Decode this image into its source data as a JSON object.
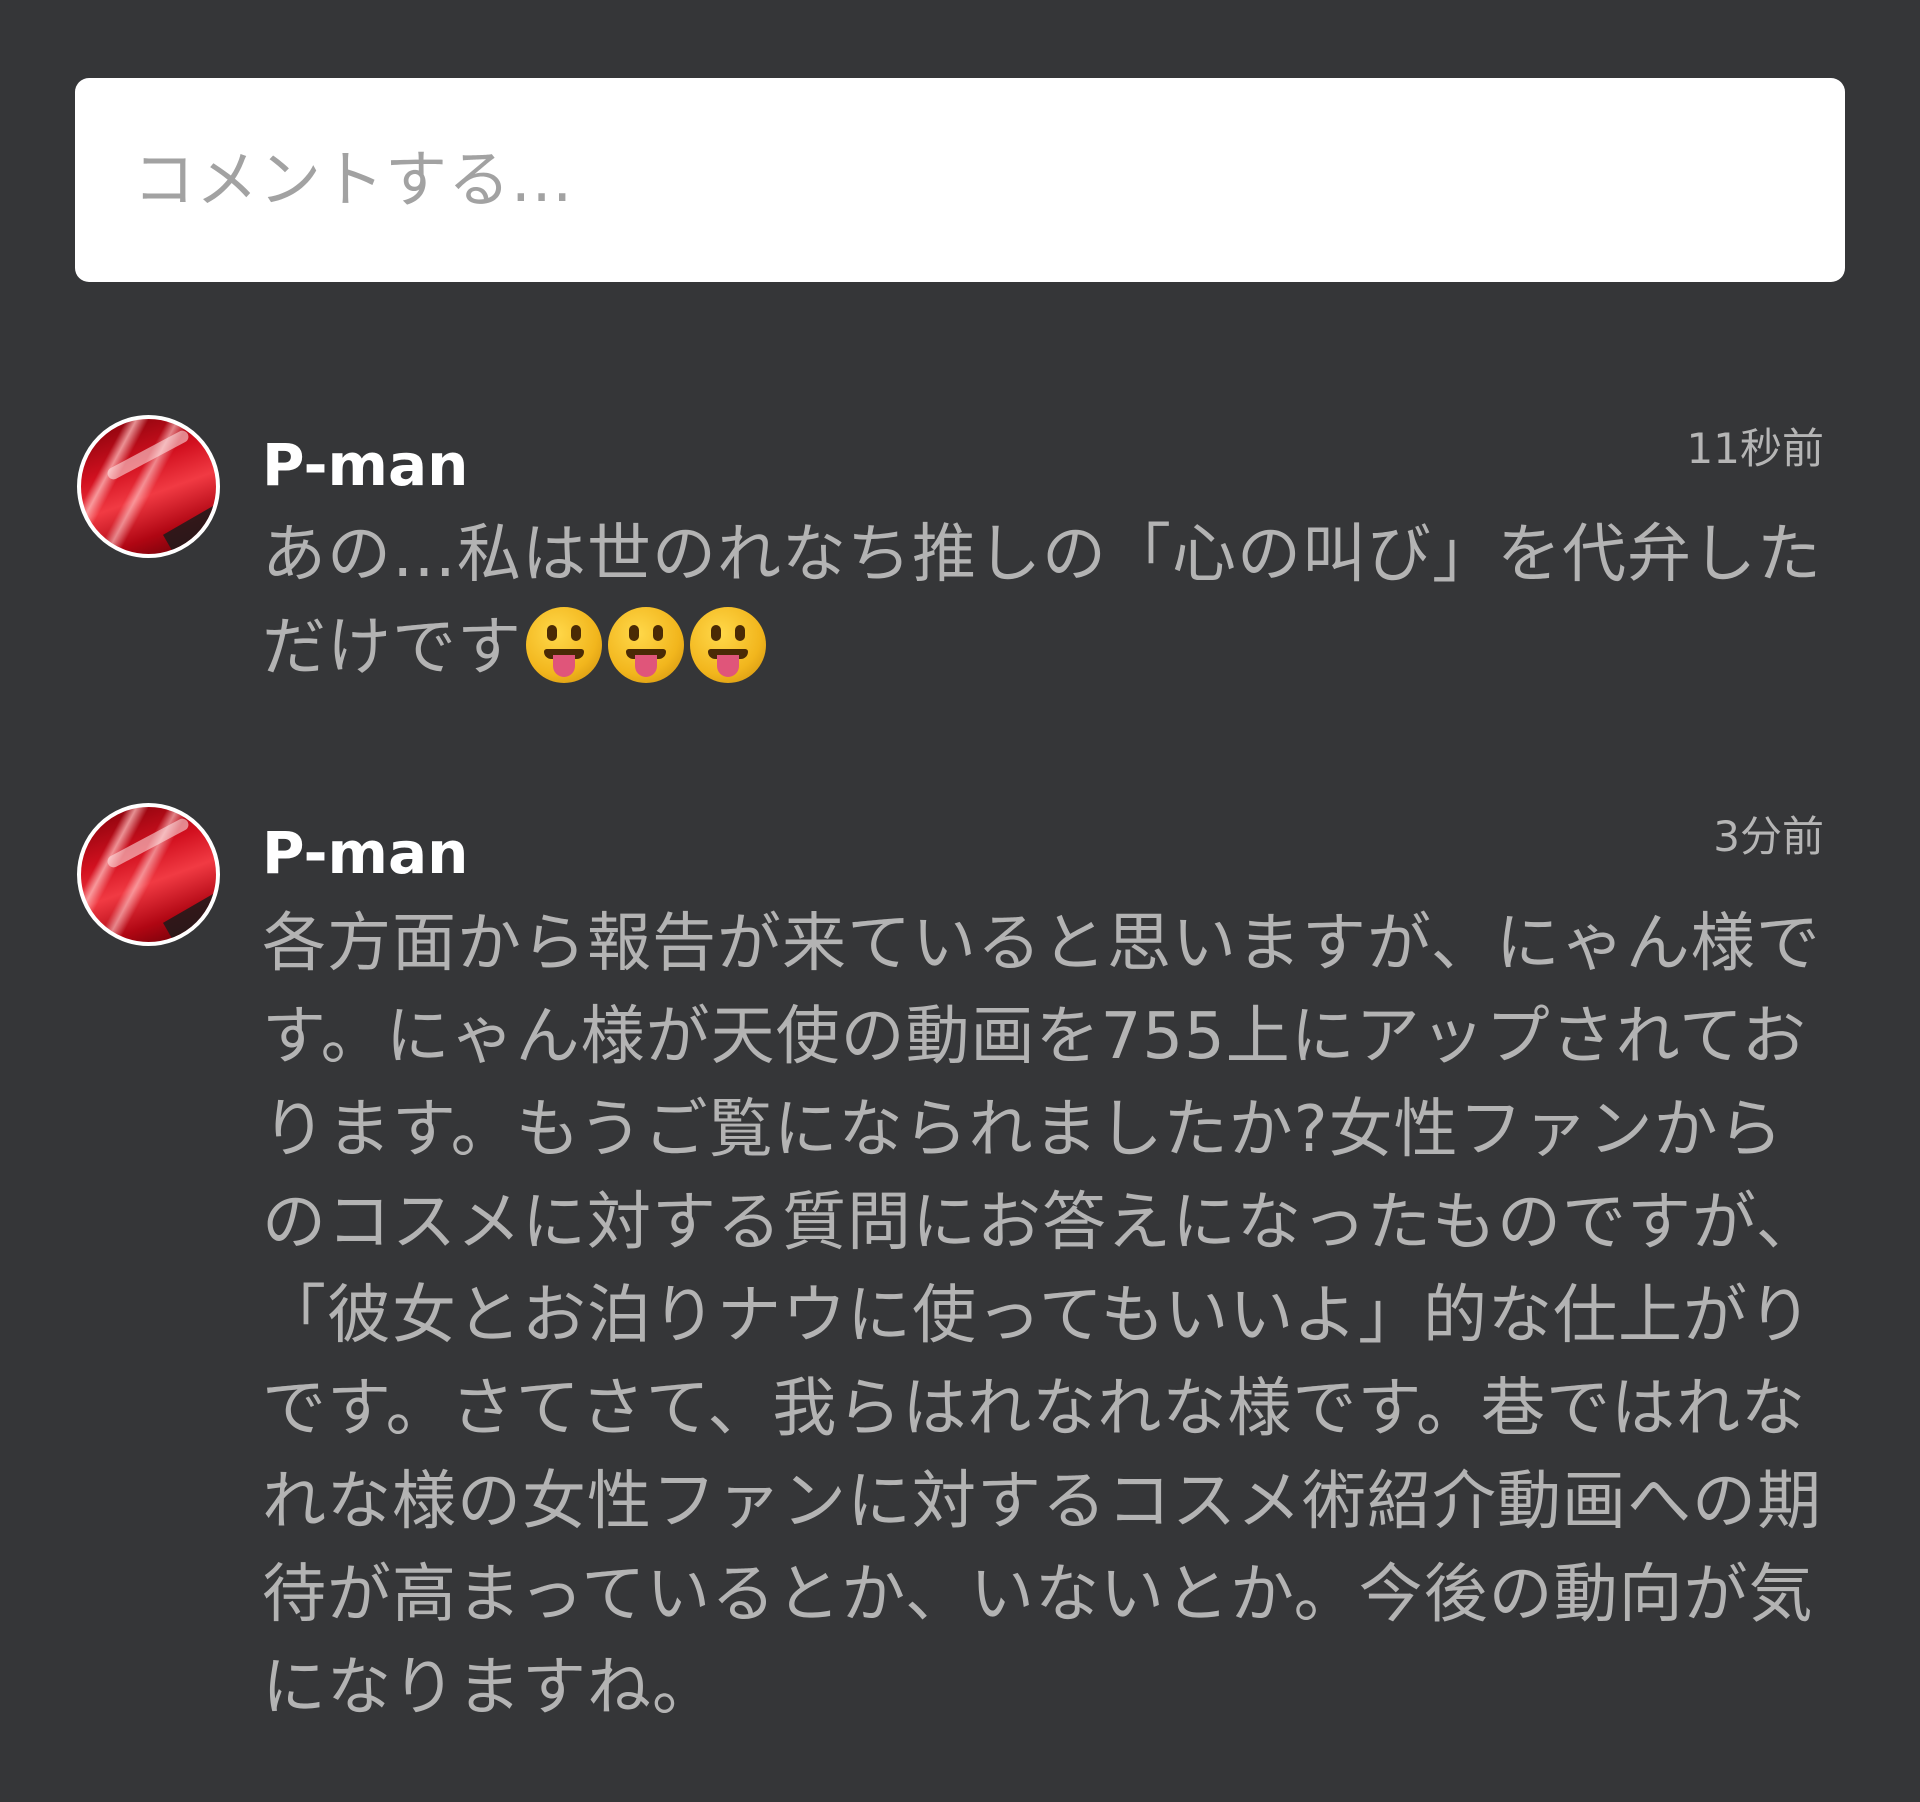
{
  "comment_input": {
    "placeholder": "コメントする..."
  },
  "comments": [
    {
      "username": "P-man",
      "timestamp": "11秒前",
      "text": "あの…私は世のれなち推しの「心の叫び」を代弁しただけです",
      "emoji": [
        "tongue-out-face-icon",
        "tongue-out-face-icon",
        "tongue-out-face-icon"
      ]
    },
    {
      "username": "P-man",
      "timestamp": "3分前",
      "text": "各方面から報告が来ていると思いますが、にゃん様です。にゃん様が天使の動画を755上にアップされております。もうご覧になられましたか?女性ファンからのコスメに対する質問にお答えになったものですが、「彼女とお泊りナウに使ってもいいよ」的な仕上がりです。さてさて、我らはれなれな様です。巷ではれなれな様の女性ファンに対するコスメ術紹介動画への期待が高まっているとか、いないとか。今後の動向が気になりますね。"
    }
  ],
  "colors": {
    "background": "#353638",
    "input_bg": "#ffffff",
    "placeholder": "#a2a2a2",
    "username": "#ffffff",
    "body_text": "#b3b3b3",
    "timestamp": "#b5b5b5"
  }
}
